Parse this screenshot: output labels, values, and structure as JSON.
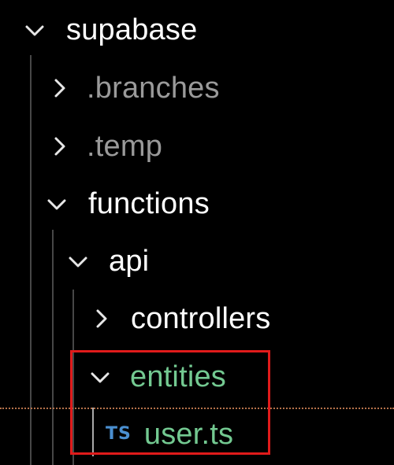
{
  "colors": {
    "background": "#000000",
    "folder_text": "#ffffff",
    "ignored_text": "#9a9a9a",
    "modified_text": "#73c991",
    "ts_badge": "#4a8fd0",
    "highlight_border": "#e01b1b"
  },
  "tree": [
    {
      "label": "supabase",
      "icon": "chevron-down-icon",
      "state": "expanded"
    },
    {
      "label": ".branches",
      "icon": "chevron-right-icon",
      "state": "collapsed"
    },
    {
      "label": ".temp",
      "icon": "chevron-right-icon",
      "state": "collapsed"
    },
    {
      "label": "functions",
      "icon": "chevron-down-icon",
      "state": "expanded"
    },
    {
      "label": "api",
      "icon": "chevron-down-icon",
      "state": "expanded"
    },
    {
      "label": "controllers",
      "icon": "chevron-right-icon",
      "state": "collapsed"
    },
    {
      "label": "entities",
      "icon": "chevron-down-icon",
      "state": "expanded"
    },
    {
      "label": "user.ts",
      "badge": "TS",
      "icon": "typescript-file-icon"
    }
  ]
}
